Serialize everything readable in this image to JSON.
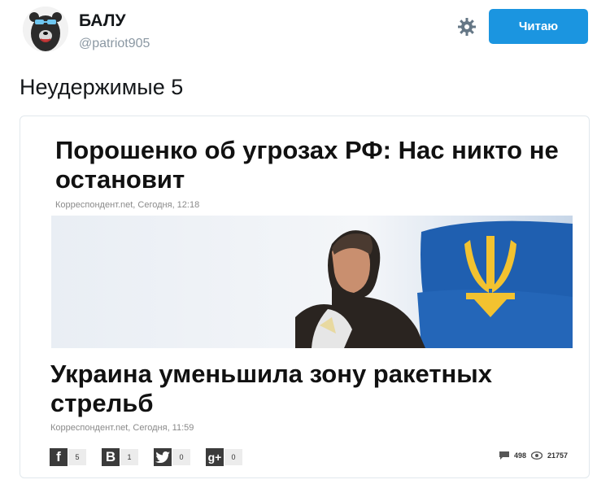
{
  "profile": {
    "display_name": "БАЛУ",
    "handle": "@patriot905"
  },
  "actions": {
    "follow_label": "Читаю",
    "settings_icon": "gear-icon"
  },
  "tweet": {
    "text": "Неудержимые 5"
  },
  "card": {
    "article1": {
      "headline": "Порошенко об угрозах РФ: Нас никто не остановит",
      "meta": "Корреспондент.net, Сегодня, 12:18"
    },
    "article2": {
      "headline": "Украина уменьшила зону ракетных стрельб",
      "meta": "Корреспондент.net, Сегодня, 11:59"
    },
    "share": [
      {
        "network": "facebook",
        "glyph": "f",
        "count": "5"
      },
      {
        "network": "vkontakte",
        "glyph": "B",
        "count": "1"
      },
      {
        "network": "twitter",
        "glyph": "",
        "count": "0"
      },
      {
        "network": "google-plus",
        "glyph": "g+",
        "count": "0"
      }
    ],
    "comments_count": "498",
    "views_count": "21757"
  },
  "colors": {
    "follow_bg": "#1b95e0",
    "handle": "#8b98a3",
    "flag_blue": "#1f5fb0",
    "flag_yellow": "#f2c230"
  }
}
